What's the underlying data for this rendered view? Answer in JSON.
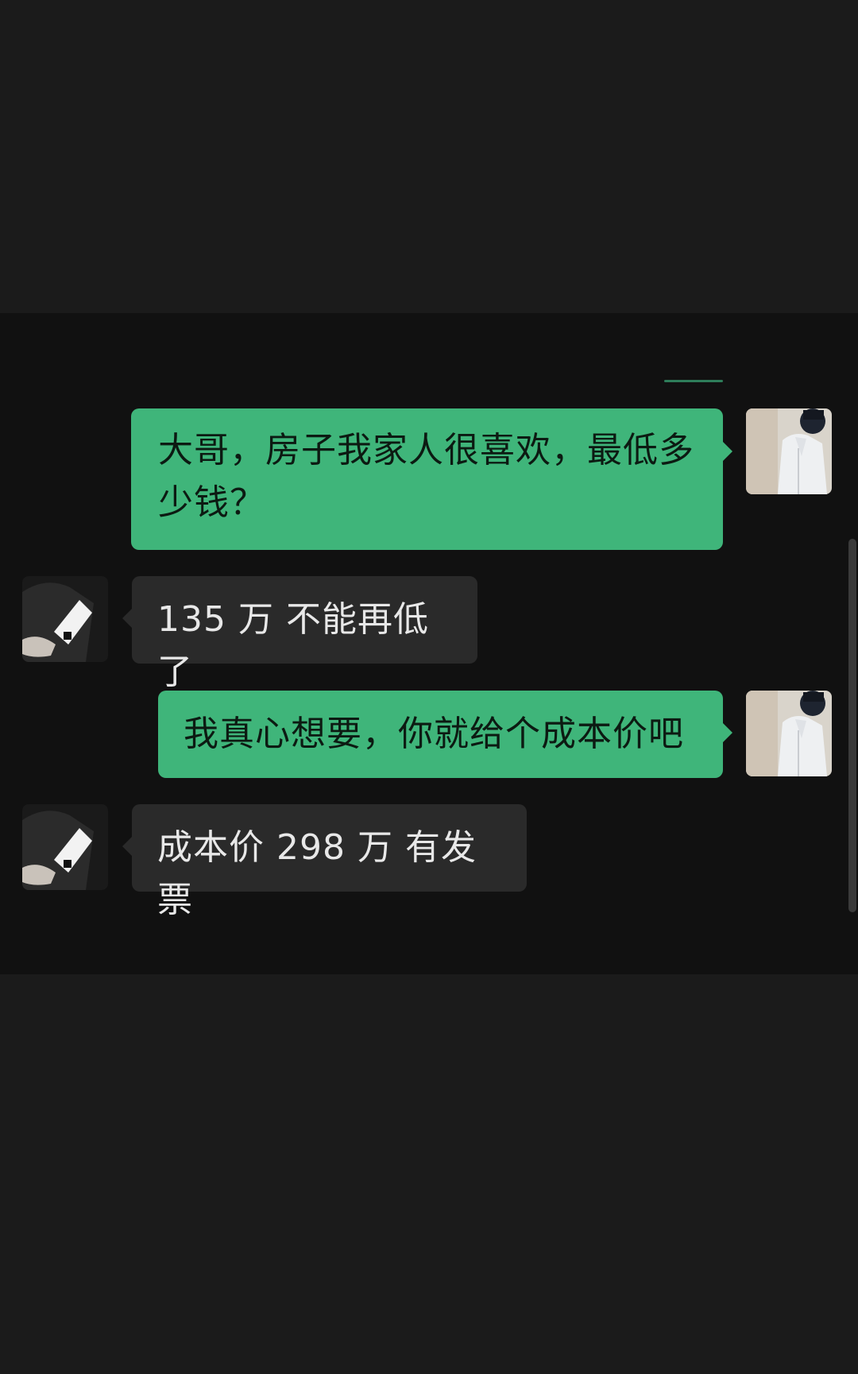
{
  "chat": {
    "messages": [
      {
        "side": "sent",
        "text": "大哥，房子我家人很喜欢，最低多少钱？",
        "avatar": "self-avatar"
      },
      {
        "side": "recv",
        "text": "135 万 不能再低了",
        "avatar": "contact-avatar"
      },
      {
        "side": "sent",
        "text": "我真心想要，你就给个成本价吧",
        "avatar": "self-avatar"
      },
      {
        "side": "recv",
        "text": "成本价 298 万 有发票",
        "avatar": "contact-avatar"
      }
    ]
  },
  "colors": {
    "sent_bubble": "#3fb57a",
    "recv_bubble": "#2a2a2a",
    "chat_bg": "#111111",
    "page_bg": "#1b1b1b"
  }
}
